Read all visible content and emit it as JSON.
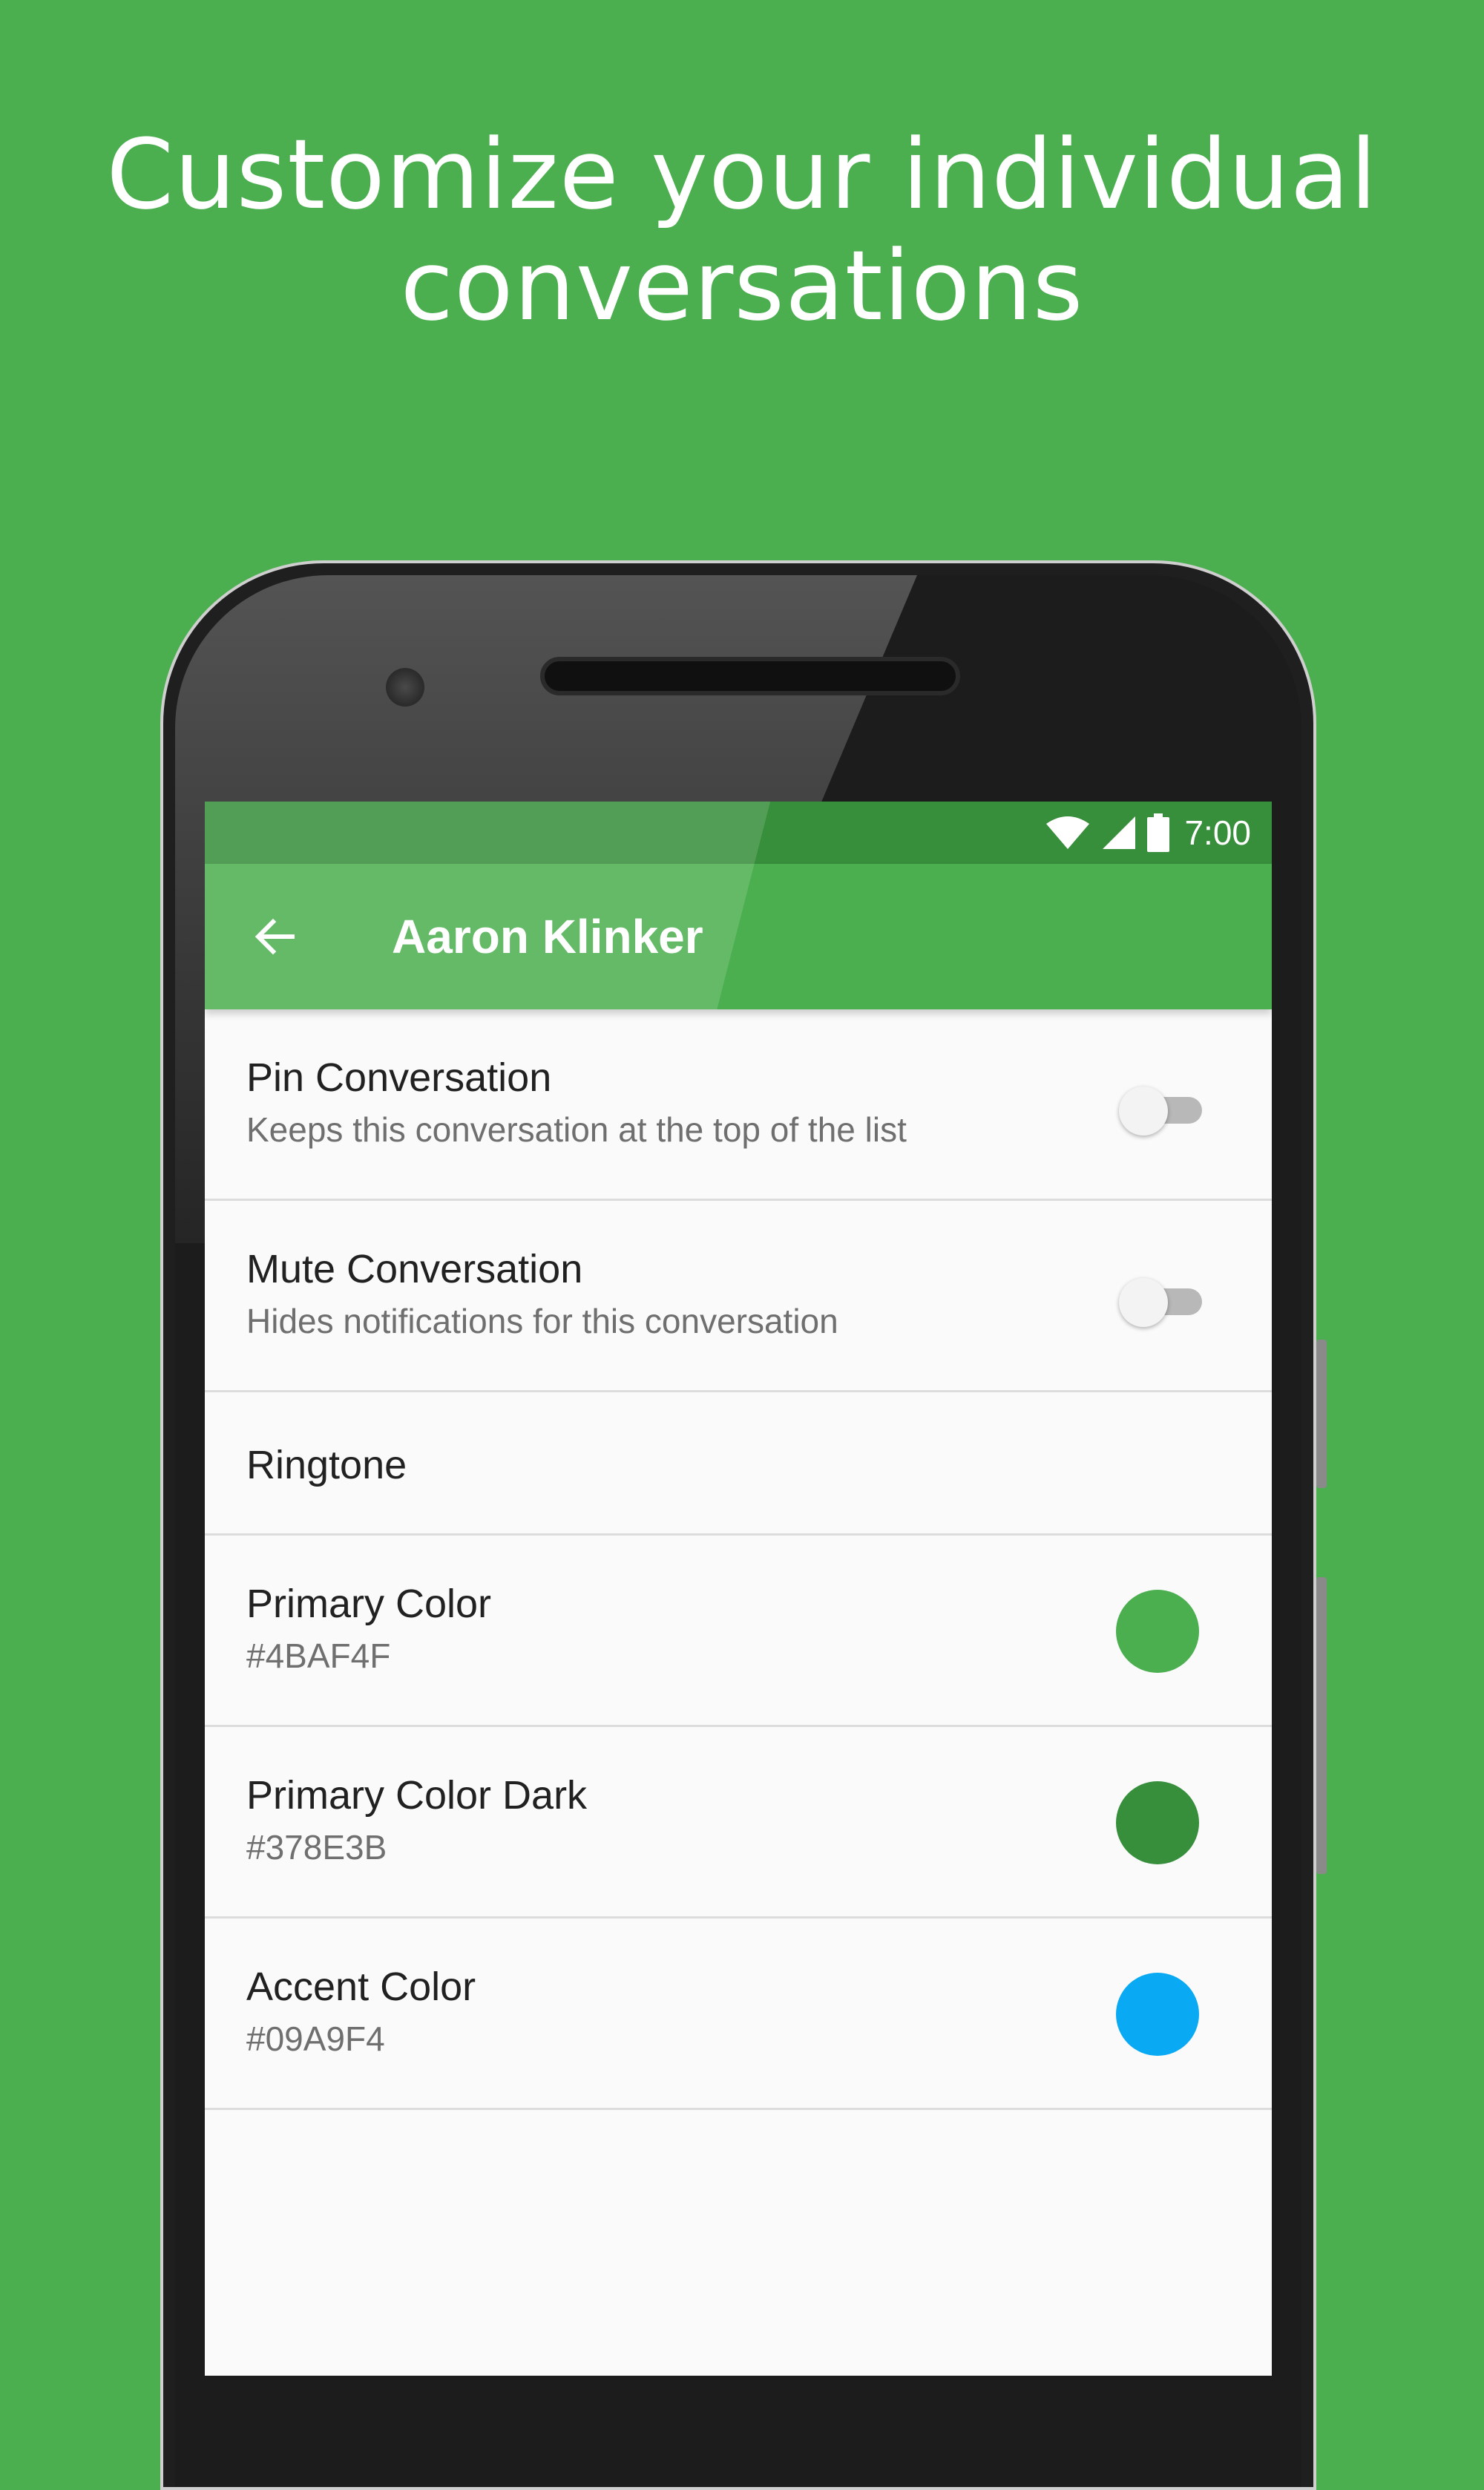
{
  "headline": {
    "line1": "Customize your individual",
    "line2": "conversations"
  },
  "status_bar": {
    "time": "7:00",
    "icons": [
      "wifi-icon",
      "cell-signal-icon",
      "battery-icon"
    ]
  },
  "app_bar": {
    "title": "Aaron Klinker",
    "back_icon": "arrow-back-icon"
  },
  "settings": {
    "pin": {
      "title": "Pin Conversation",
      "summary": "Keeps this conversation at the top of the list",
      "enabled": false
    },
    "mute": {
      "title": "Mute Conversation",
      "summary": "Hides notifications for this conversation",
      "enabled": false
    },
    "ringtone": {
      "title": "Ringtone"
    },
    "primary_color": {
      "title": "Primary Color",
      "value": "#4BAF4F",
      "swatch": "#4BAF4F"
    },
    "primary_color_dark": {
      "title": "Primary Color Dark",
      "value": "#378E3B",
      "swatch": "#378E3B"
    },
    "accent_color": {
      "title": "Accent Color",
      "value": "#09A9F4",
      "swatch": "#09A9F4"
    }
  },
  "colors": {
    "background": "#4BAF4F",
    "status_bar": "#378E3B",
    "app_bar": "#4BAF4F"
  }
}
